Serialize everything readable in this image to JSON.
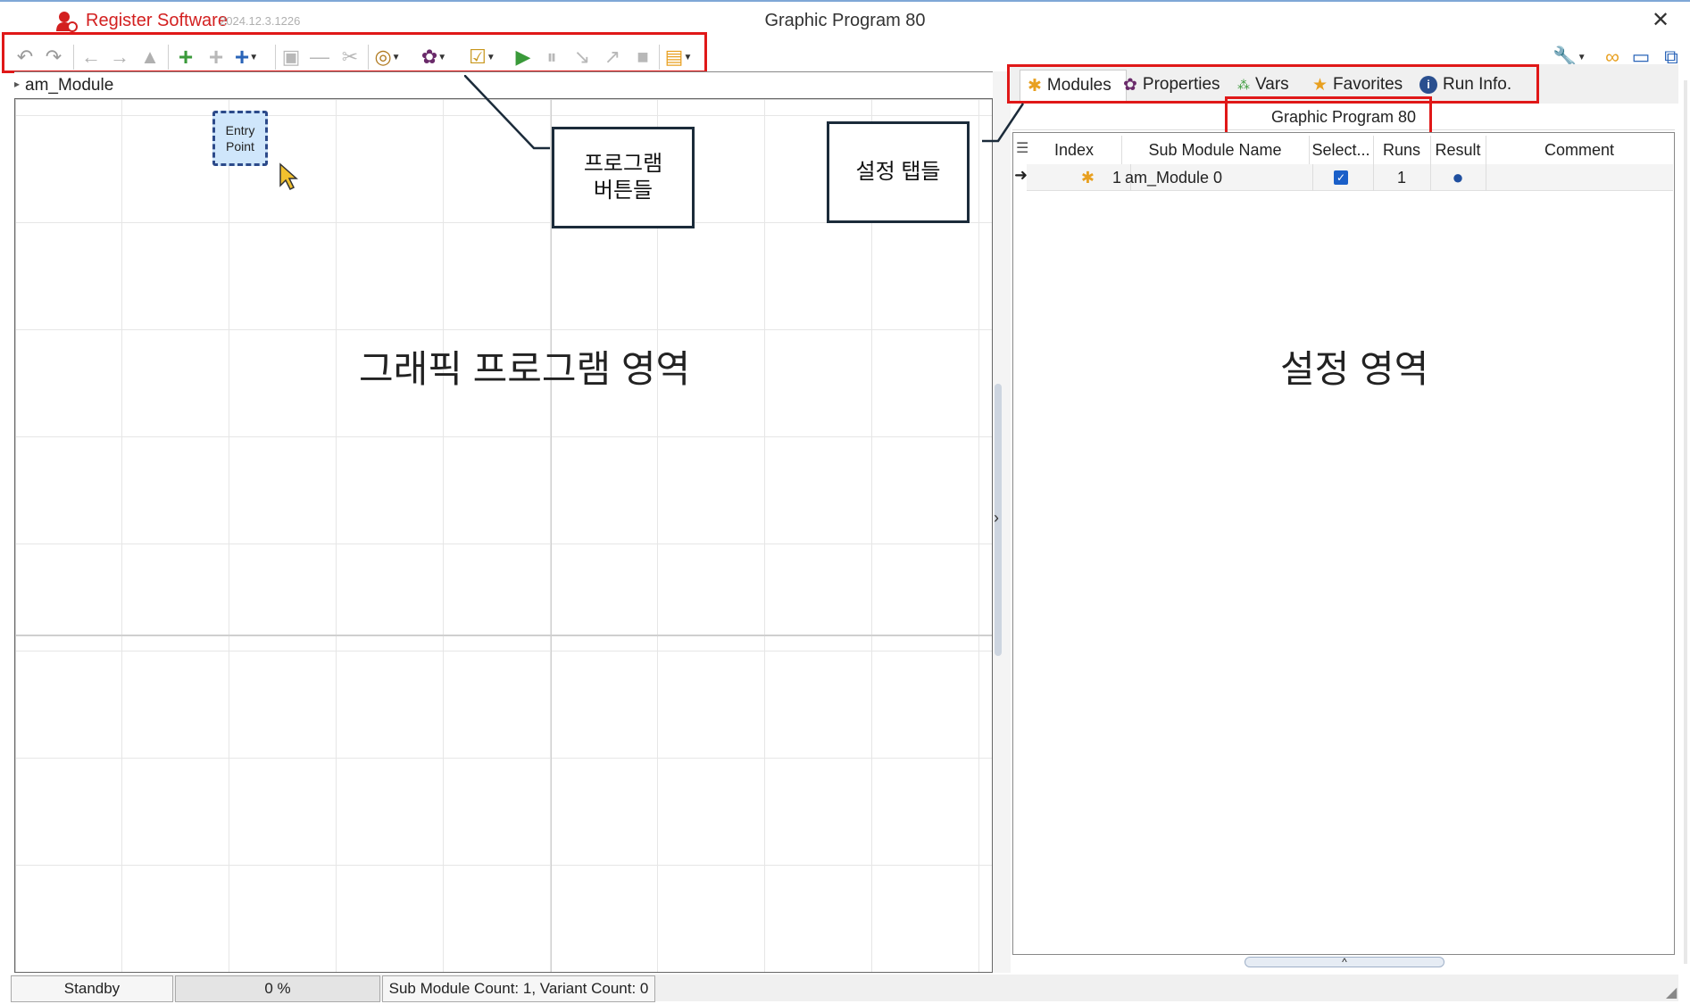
{
  "window": {
    "app_name": "Register Software",
    "version": "2024.12.3.1226",
    "title": "Graphic Program 80",
    "close": "✕"
  },
  "breadcrumb": {
    "marker": "▸",
    "label": "am_Module"
  },
  "entry_node": {
    "line1": "Entry",
    "line2": "Point"
  },
  "annotations": {
    "graphic_area": "그래픽 프로그램 영역",
    "settings_area": "설정 영역",
    "program_buttons_line1": "프로그램",
    "program_buttons_line2": "버튼들",
    "settings_tabs": "설정 탭들"
  },
  "tabs": [
    {
      "label": "Modules",
      "icon": "puzzle-icon"
    },
    {
      "label": "Properties",
      "icon": "gear-icon"
    },
    {
      "label": "Vars",
      "icon": "vars-icon"
    },
    {
      "label": "Favorites",
      "icon": "star-icon"
    },
    {
      "label": "Run Info.",
      "icon": "info-icon"
    }
  ],
  "panel_title": "Graphic Program 80",
  "grid": {
    "columns": [
      "Index",
      "Sub Module Name",
      "Select...",
      "Runs",
      "Result",
      "Comment"
    ],
    "rows": [
      {
        "index": "1",
        "name": "am_Module 0",
        "selected": true,
        "runs": "1",
        "result": "●",
        "comment": ""
      }
    ]
  },
  "status": {
    "state": "Standby",
    "progress": "0 %",
    "counts": "Sub Module Count: 1, Variant Count: 0"
  },
  "colors": {
    "accent_red": "#e01818",
    "toolbar_green": "#3a9a3a",
    "toolbar_blue": "#2a64b8",
    "icon_orange": "#e8a020",
    "icon_purple": "#6a2a6a"
  }
}
